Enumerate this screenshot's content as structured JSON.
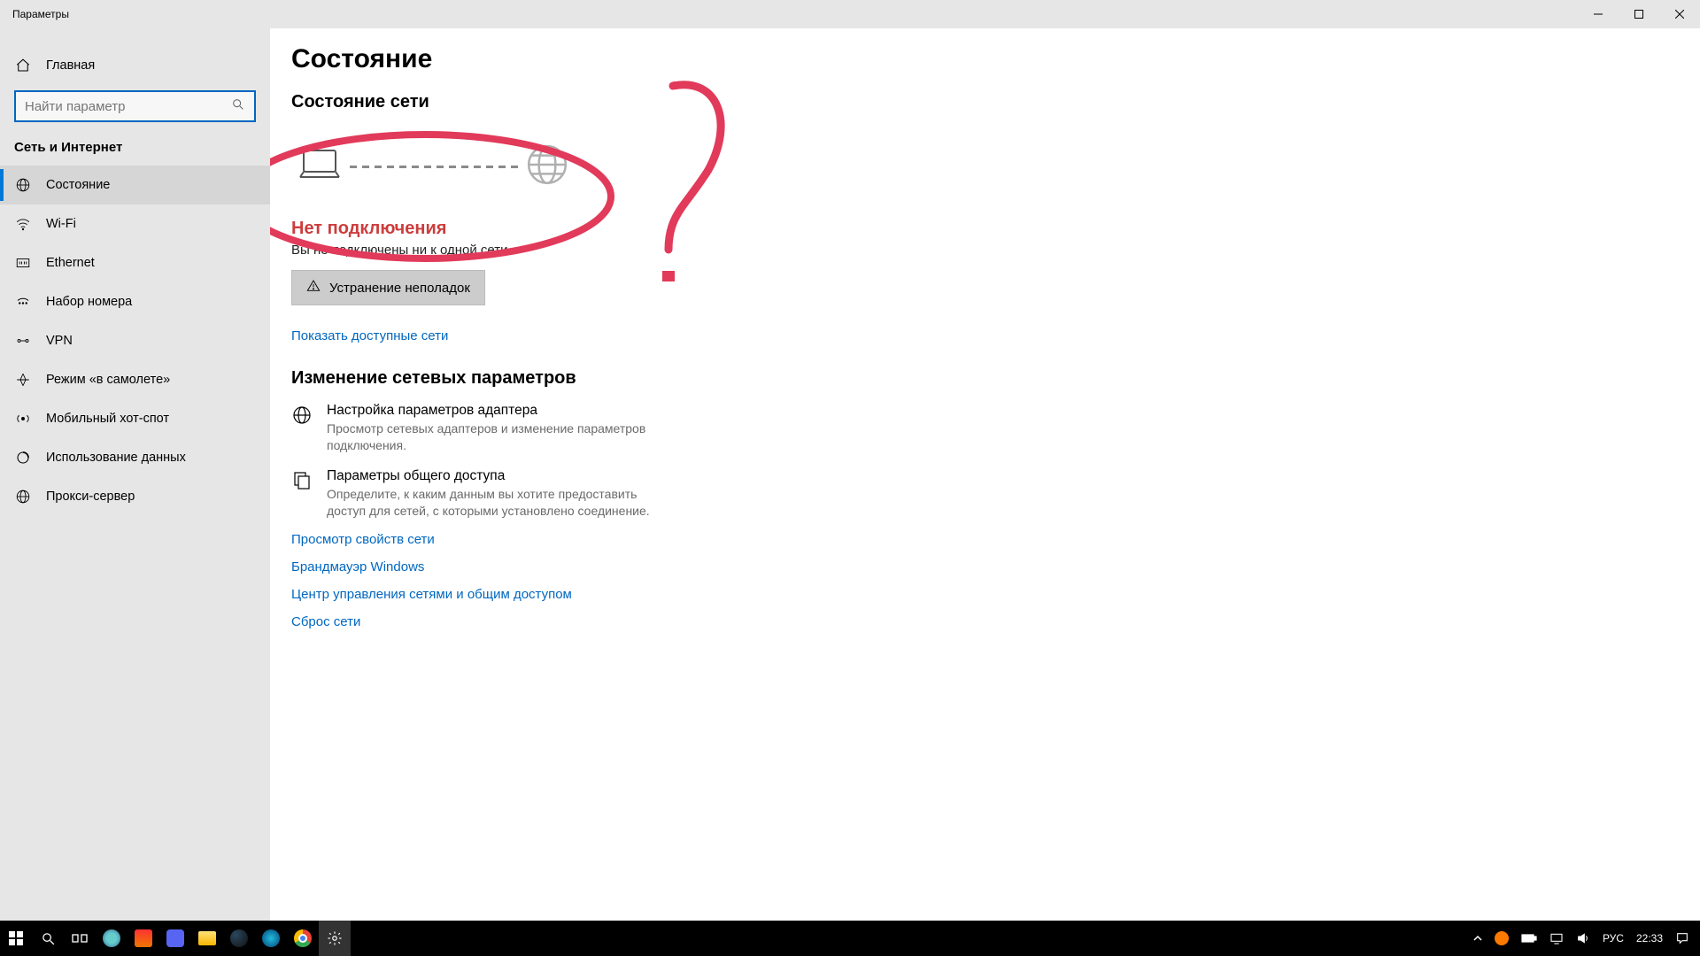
{
  "window": {
    "title": "Параметры"
  },
  "sidebar": {
    "home": "Главная",
    "search_placeholder": "Найти параметр",
    "category": "Сеть и Интернет",
    "items": [
      {
        "label": "Состояние"
      },
      {
        "label": "Wi-Fi"
      },
      {
        "label": "Ethernet"
      },
      {
        "label": "Набор номера"
      },
      {
        "label": "VPN"
      },
      {
        "label": "Режим «в самолете»"
      },
      {
        "label": "Мобильный хот-спот"
      },
      {
        "label": "Использование данных"
      },
      {
        "label": "Прокси-сервер"
      }
    ]
  },
  "main": {
    "title": "Состояние",
    "subtitle": "Состояние сети",
    "no_conn_title": "Нет подключения",
    "no_conn_sub": "Вы не подключены ни к одной сети.",
    "troubleshoot": "Устранение неполадок",
    "show_networks": "Показать доступные сети",
    "change_settings": "Изменение сетевых параметров",
    "adapter_title": "Настройка параметров адаптера",
    "adapter_desc": "Просмотр сетевых адаптеров и изменение параметров подключения.",
    "sharing_title": "Параметры общего доступа",
    "sharing_desc": "Определите, к каким данным вы хотите предоставить доступ для сетей, с которыми установлено соединение.",
    "links": {
      "props": "Просмотр свойств сети",
      "firewall": "Брандмауэр Windows",
      "center": "Центр управления сетями и общим доступом",
      "reset": "Сброс сети"
    }
  },
  "taskbar": {
    "lang": "РУС",
    "time": "22:33"
  }
}
